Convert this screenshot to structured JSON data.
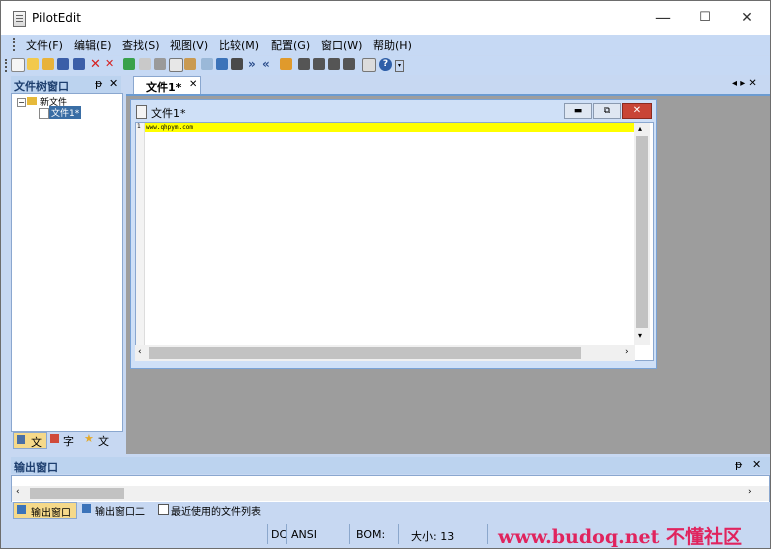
{
  "window": {
    "title": "PilotEdit",
    "minimize": "—",
    "maximize": "☐",
    "close": "✕"
  },
  "menu": [
    "文件(F)",
    "编辑(E)",
    "查找(S)",
    "视图(V)",
    "比较(M)",
    "配置(G)",
    "窗口(W)",
    "帮助(H)"
  ],
  "left_panel": {
    "title": "文件树窗口",
    "pin": "ᵽ",
    "close": "✕",
    "tree": {
      "root": "新文件",
      "child": "文件1*"
    },
    "tabs": [
      "文",
      "字",
      "文"
    ]
  },
  "doc_tabs": {
    "active": "文件1*",
    "close": "✕",
    "nav": "◂ ▸ ✕"
  },
  "editor": {
    "title": "文件1*",
    "line_number": "1",
    "line_text": "www.qhpym.com"
  },
  "output": {
    "title": "输出窗口",
    "pin": "ᵽ",
    "close": "✕",
    "tabs": [
      "输出窗口",
      "输出窗口二",
      "最近使用的文件列表"
    ]
  },
  "status": {
    "encoding_short": "DC",
    "encoding": "ANSI",
    "bom": "BOM:",
    "size": "大小: 13"
  },
  "watermark": "www.budoq.net 不懂社区",
  "colors": {
    "highlight_line": "#ffff00",
    "watermark": "#e0245e",
    "accent": "#3a6ea5"
  }
}
